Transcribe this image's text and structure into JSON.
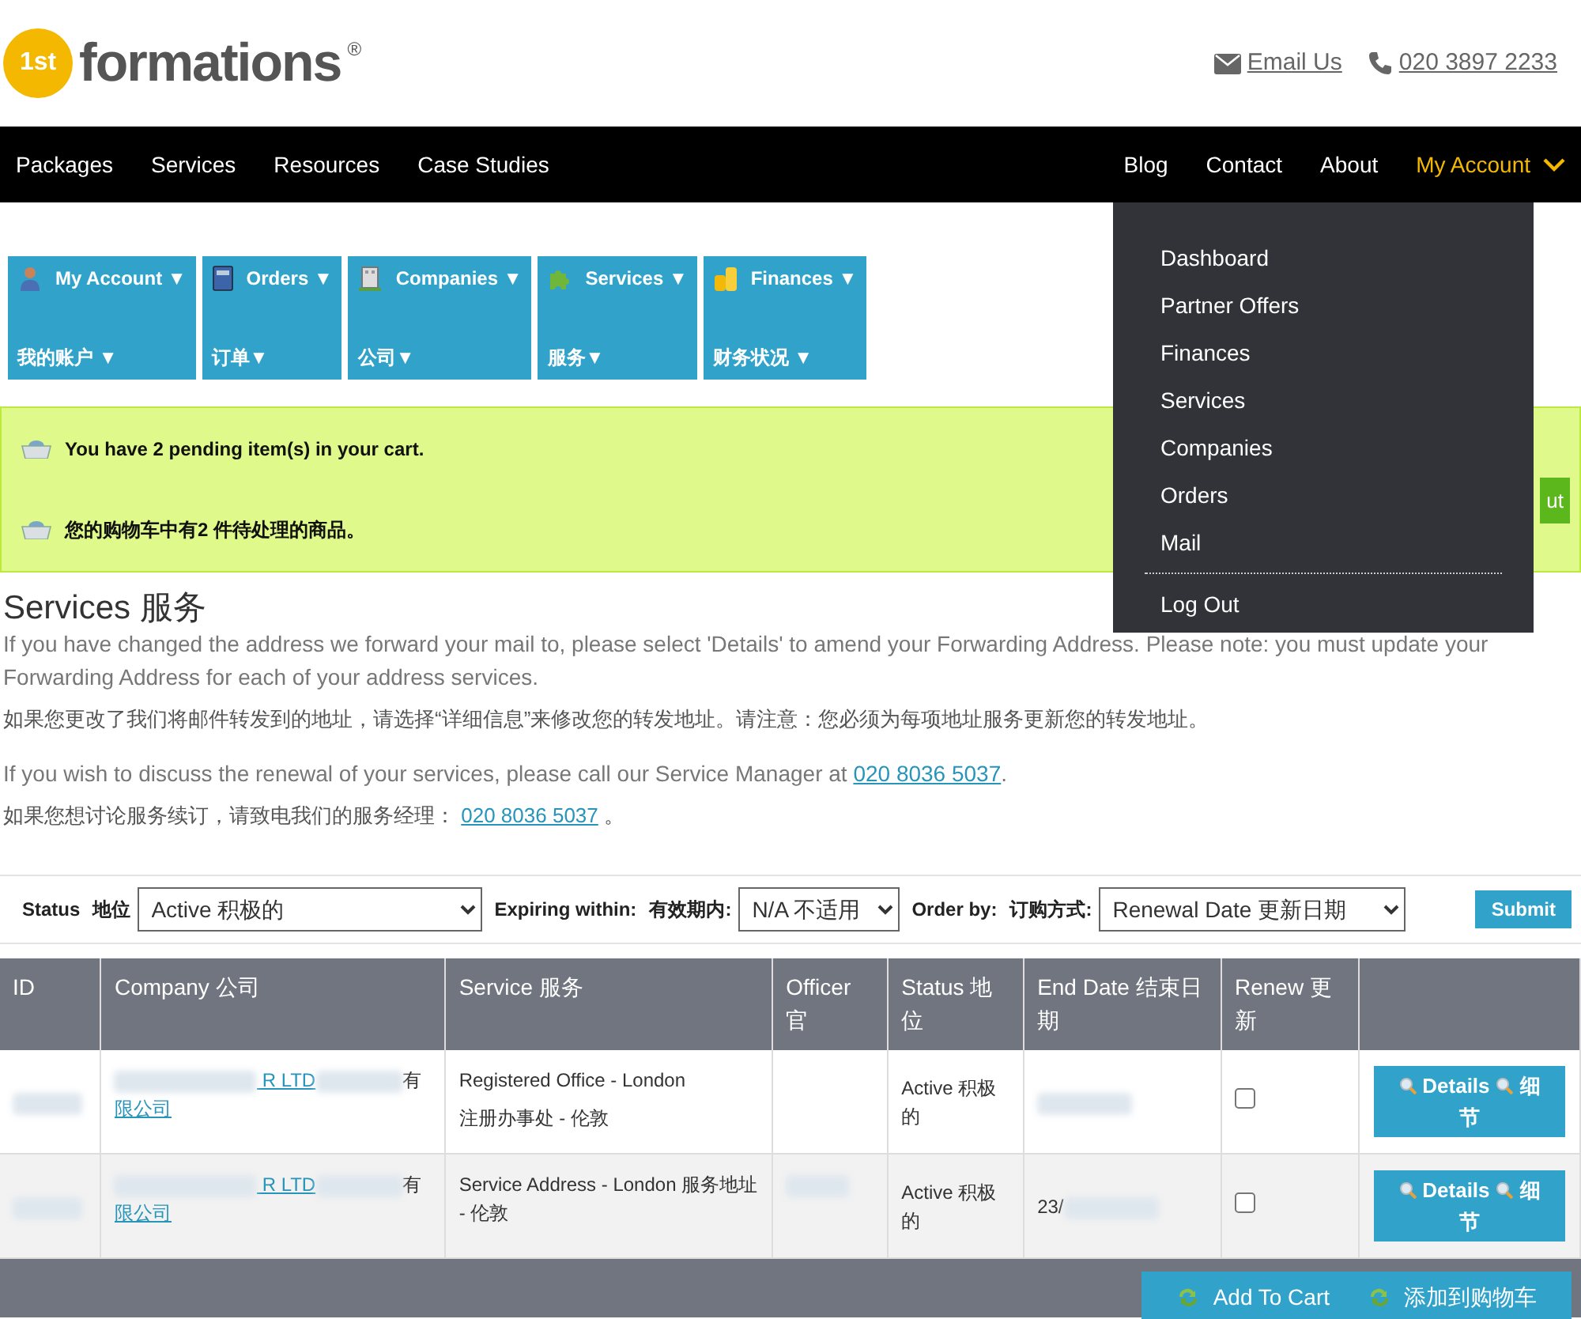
{
  "header": {
    "logo": {
      "mark": "1st",
      "word": "formations",
      "registered": "®"
    },
    "contacts": [
      {
        "kind": "email",
        "label": "Email Us"
      },
      {
        "kind": "phone",
        "label": "020 3897 2233"
      }
    ]
  },
  "nav": {
    "left": [
      {
        "label": "Packages",
        "selected": false
      },
      {
        "label": "Services",
        "selected": false
      },
      {
        "label": "Resources",
        "selected": false
      },
      {
        "label": "Case Studies",
        "selected": false
      }
    ],
    "right": [
      {
        "label": "Blog",
        "selected": false,
        "dropdown": false
      },
      {
        "label": "Contact",
        "selected": false,
        "dropdown": false
      },
      {
        "label": "About",
        "selected": false,
        "dropdown": false
      },
      {
        "label": "My Account",
        "selected": true,
        "dropdown": true
      }
    ]
  },
  "account_menu": {
    "items": [
      "Dashboard",
      "Partner Offers",
      "Finances",
      "Services",
      "Companies",
      "Orders",
      "Mail"
    ],
    "footer_item": "Log Out"
  },
  "tabs": [
    {
      "label": "My Account ▼",
      "label_zh": "我的账户 ▼"
    },
    {
      "label": "Orders ▼",
      "label_zh": "订单▼"
    },
    {
      "label": "Companies ▼",
      "label_zh": "公司▼"
    },
    {
      "label": "Services ▼",
      "label_zh": "服务▼"
    },
    {
      "label": "Finances ▼",
      "label_zh": "财务状况 ▼"
    }
  ],
  "cart_alert": {
    "lines": [
      "You have 2 pending item(s) in your cart.",
      "您的购物车中有2 件待处理的商品。"
    ],
    "button": "ut"
  },
  "page": {
    "title": "Services 服务",
    "paragraphs": [
      {
        "text": "If you have changed the address we forward your mail to, please select 'Details' to amend your Forwarding Address. Please note: you must update your Forwarding Address for each of your address services."
      },
      {
        "text": "如果您更改了我们将邮件转发到的地址，请选择“详细信息”来修改您的转发地址。请注意：您必须为每项地址服务更新您的转发地址。"
      },
      {
        "text": "If you wish to discuss the renewal of your services, please call our Service Manager at ",
        "link": "020 8036 5037",
        "after": "."
      },
      {
        "text": "如果您想讨论服务续订，请致电我们的服务经理： ",
        "link": "020 8036 5037",
        "after": " 。"
      }
    ]
  },
  "filters": [
    {
      "label": "Status",
      "label_zh": "地位",
      "value": "Active 积极的"
    },
    {
      "label": "Expiring within:",
      "label_zh": "有效期内:",
      "value": "N/A 不适用"
    },
    {
      "label": "Order by:",
      "label_zh": "订购方式:",
      "value": "Renewal Date 更新日期"
    }
  ],
  "submit": "Submit",
  "table": {
    "columns": [
      "ID",
      "Company 公司",
      "Service 服务",
      "Officer 官",
      "Status 地位",
      "End Date 结束日期",
      "Renew 更新"
    ],
    "rows": [
      {
        "id_redacted": true,
        "company": "R LTD",
        "company_tail": "有",
        "company_line2": "限公司",
        "service": "Registered Office - London",
        "service_zh": "注册办事处 - 伦敦",
        "officer_redacted": false,
        "status": "Active 积极的",
        "end_date_redacted": true,
        "renew": false,
        "details": "Details",
        "details_zh": "细节"
      },
      {
        "id_redacted": true,
        "company": "R LTD",
        "company_tail": "有",
        "company_line2": "限公司",
        "service": "Service Address - London 服务地址 - 伦敦",
        "officer_redacted": true,
        "status": "Active 积极的",
        "end_date": "23/",
        "end_date_redacted": true,
        "renew": false,
        "details": "Details",
        "details_zh": "细节"
      }
    ],
    "add_to_cart": {
      "label": "Add To Cart",
      "label_zh": "添加到购物车"
    }
  }
}
